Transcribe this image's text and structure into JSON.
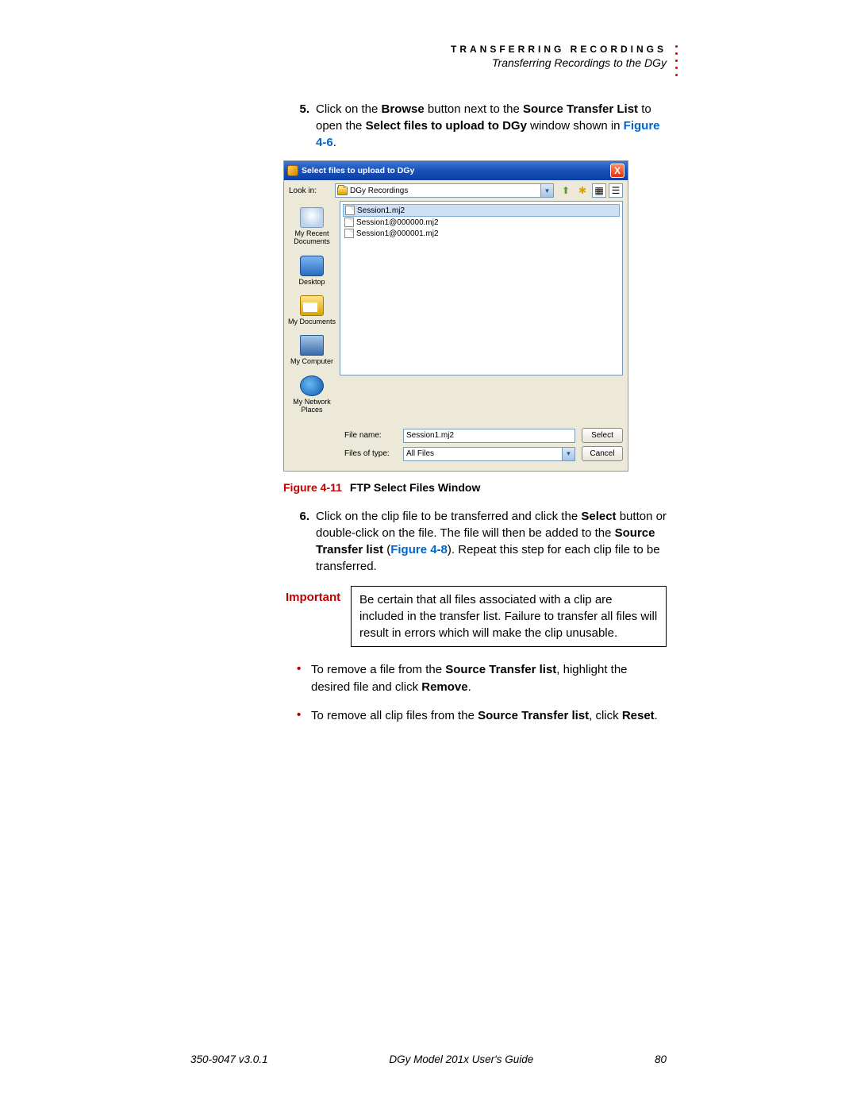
{
  "header": {
    "title": "TRANSFERRING RECORDINGS",
    "subtitle": "Transferring Recordings to the DGy"
  },
  "step5": {
    "num": "5.",
    "pre": "Click on the ",
    "browse": "Browse",
    "mid1": " button next to the ",
    "stl": "Source Transfer List",
    "mid2": " to open the ",
    "select_bold": "Select files to upload to DGy",
    "mid3": " window shown in ",
    "figref": "Figure 4-6",
    "end": "."
  },
  "dialog": {
    "title": "Select files to upload to DGy",
    "close": "X",
    "lookin_label": "Look in:",
    "lookin_value": "DGy Recordings",
    "files": [
      "Session1.mj2",
      "Session1@000000.mj2",
      "Session1@000001.mj2"
    ],
    "places": {
      "recent": "My Recent Documents",
      "desktop": "Desktop",
      "mydoc": "My Documents",
      "mycomp": "My Computer",
      "mynet": "My Network Places"
    },
    "filename_label": "File name:",
    "filename_value": "Session1.mj2",
    "filetype_label": "Files of type:",
    "filetype_value": "All Files",
    "select_btn": "Select",
    "cancel_btn": "Cancel"
  },
  "figure": {
    "num": "Figure 4-11",
    "title": "FTP Select Files Window"
  },
  "step6": {
    "num": "6.",
    "pre": "Click on the clip file to be transferred and click the ",
    "select": "Select",
    "mid1": " button or double-click on the file. The file will then be added to the ",
    "stl": "Source Transfer list",
    "open_paren": " (",
    "figref": "Figure 4-8",
    "close_paren": "). Repeat this step for each clip file to be transferred."
  },
  "important": {
    "label": "Important",
    "text": "Be certain that all files associated with a clip are included in the transfer list. Failure to transfer all files will result in errors which will make the clip unusable."
  },
  "bullet1": {
    "pre": "To remove a file from the ",
    "stl": "Source Transfer list",
    "mid": ", highlight the desired file and click ",
    "remove": "Remove",
    "end": "."
  },
  "bullet2": {
    "pre": "To remove all clip files from the ",
    "stl": "Source Transfer list",
    "mid": ", click ",
    "reset": "Reset",
    "end": "."
  },
  "footer": {
    "left": "350-9047 v3.0.1",
    "center": "DGy Model 201x User's Guide",
    "right": "80"
  }
}
